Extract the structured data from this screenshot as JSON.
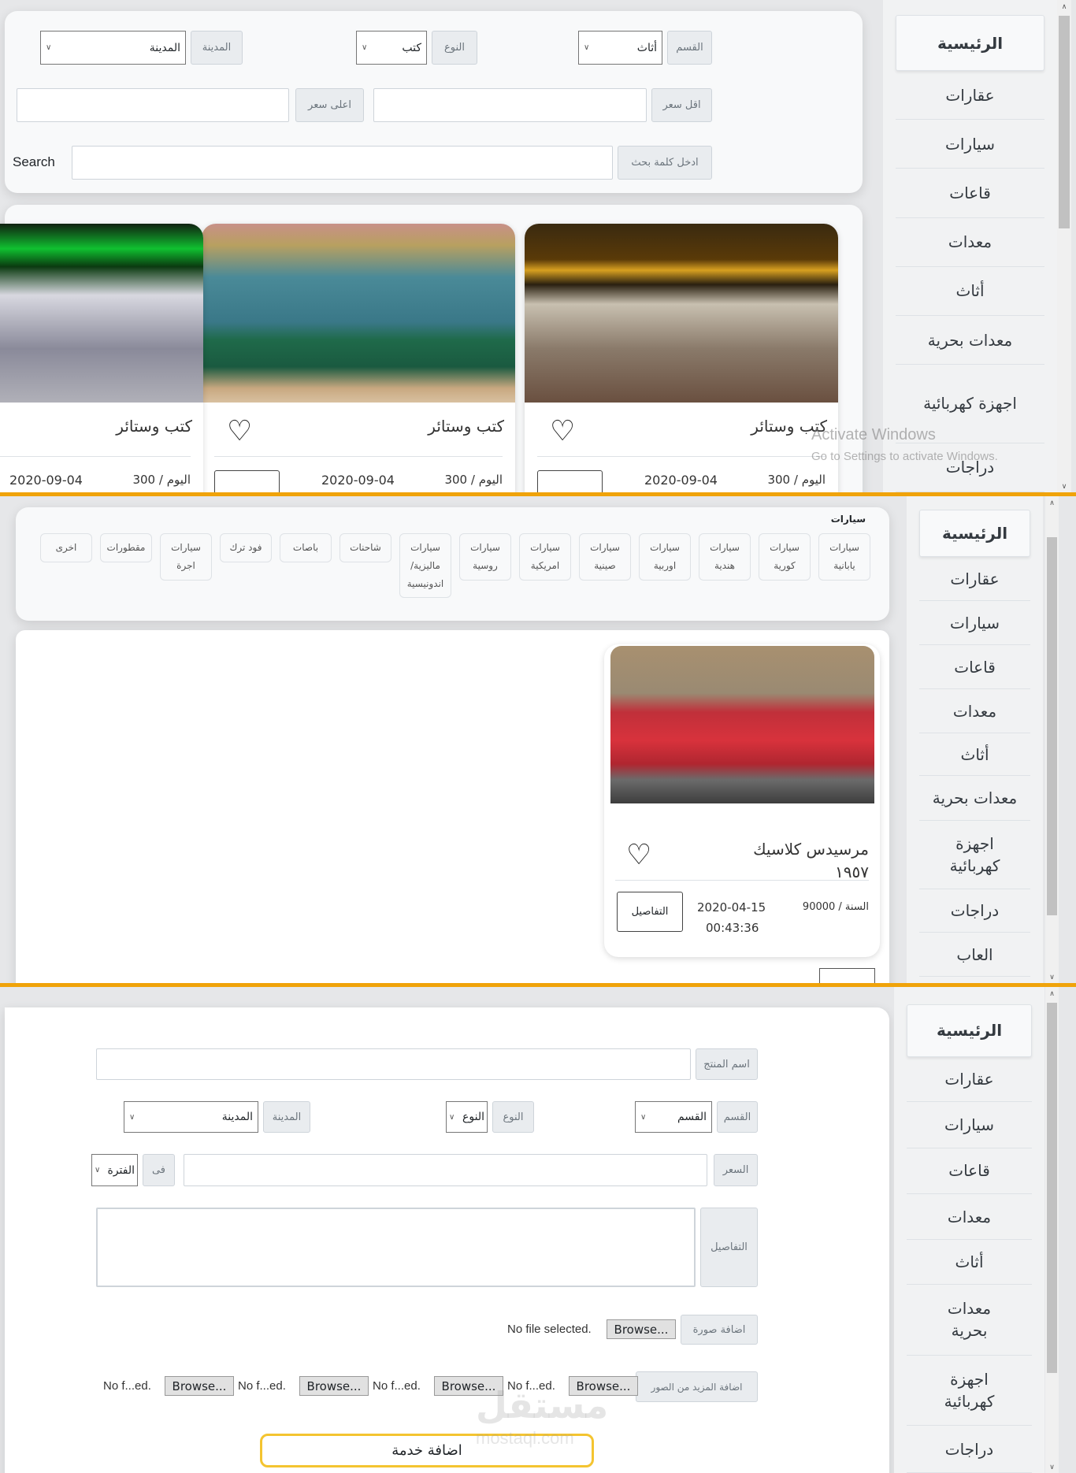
{
  "sidebar": {
    "items": [
      "الرئيسية",
      "عقارات",
      "سيارات",
      "قاعات",
      "معدات",
      "أثاث",
      "معدات بحرية",
      "اجهزة كهربائية",
      "دراجات",
      "العاب"
    ]
  },
  "filters": {
    "category_label": "القسم",
    "category_value": "أثاث",
    "type_label": "النوع",
    "type_value": "كتب",
    "city_label": "المدينة",
    "city_value": "المدينة",
    "min_price_label": "اقل سعر",
    "max_price_label": "اعلى سعر",
    "keyword_label": "ادخل كلمة بحث",
    "search_label": "Search"
  },
  "listings": [
    {
      "title": "كتب وستائر",
      "price": "اليوم / 300",
      "date": "2020-09-04"
    },
    {
      "title": "كتب وستائر",
      "price": "اليوم / 300",
      "date": "2020-09-04"
    },
    {
      "title": "كتب وستائر",
      "price": "اليوم / 300",
      "date": "2020-09-04"
    }
  ],
  "cars": {
    "heading": "سيارات",
    "chips": [
      "سيارات يابانية",
      "سيارات كورية",
      "سيارات هندية",
      "سيارات اوربية",
      "سيارات صينية",
      "سيارات امريكية",
      "سيارات روسية",
      "سيارات ماليزية/ اندونيسية",
      "شاحنات",
      "باصات",
      "فود ترك",
      "سيارات اجرة",
      "مقطورات",
      "اخرى"
    ],
    "card": {
      "title": "مرسيدس كلاسيك ١٩٥٧",
      "price": "السنة / 90000",
      "date": "2020-04-15",
      "time": "00:43:36",
      "details_button": "التفاصيل"
    }
  },
  "form": {
    "product_name_label": "اسم المنتج",
    "category_label": "القسم",
    "category_value": "القسم",
    "type_label": "النوع",
    "type_value": "النوع",
    "city_label": "المدينة",
    "city_value": "المدينة",
    "price_label": "السعر",
    "in_label": "فى",
    "period_value": "الفترة",
    "details_label": "التفاصيل",
    "image_label": "اضافة صورة",
    "browse": "Browse...",
    "no_file": "No file selected.",
    "more_images_label": "اضافة المزيد من الصور",
    "no_file_short": "No f...ed.",
    "submit": "اضافة خدمة"
  },
  "overlay": {
    "activate_title": "Activate Windows",
    "activate_sub": "Go to Settings to activate Windows.",
    "watermark": "مستقل",
    "watermark_sub": "mostaql.com"
  },
  "colors": {
    "accent": "#f0a30a",
    "panel": "#f8f9fa"
  }
}
